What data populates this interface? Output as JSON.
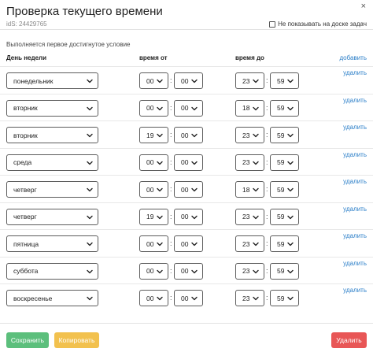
{
  "header": {
    "title": "Проверка текущего времени",
    "ids": "idS: 24429765",
    "close_glyph": "×",
    "hide_label": "Не показывать на доске задач"
  },
  "subtitle": "Выполняется первое достигнутое условие",
  "columns": {
    "day": "День недели",
    "from": "время от",
    "to": "время до",
    "add": "добавить"
  },
  "delete_label": "удалить",
  "rows": [
    {
      "day": "понедельник",
      "from_h": "00",
      "from_m": "00",
      "to_h": "23",
      "to_m": "59"
    },
    {
      "day": "вторник",
      "from_h": "00",
      "from_m": "00",
      "to_h": "18",
      "to_m": "59"
    },
    {
      "day": "вторник",
      "from_h": "19",
      "from_m": "00",
      "to_h": "23",
      "to_m": "59"
    },
    {
      "day": "среда",
      "from_h": "00",
      "from_m": "00",
      "to_h": "23",
      "to_m": "59"
    },
    {
      "day": "четверг",
      "from_h": "00",
      "from_m": "00",
      "to_h": "18",
      "to_m": "59"
    },
    {
      "day": "четверг",
      "from_h": "19",
      "from_m": "00",
      "to_h": "23",
      "to_m": "59"
    },
    {
      "day": "пятница",
      "from_h": "00",
      "from_m": "00",
      "to_h": "23",
      "to_m": "59"
    },
    {
      "day": "суббота",
      "from_h": "00",
      "from_m": "00",
      "to_h": "23",
      "to_m": "59"
    },
    {
      "day": "воскресенье",
      "from_h": "00",
      "from_m": "00",
      "to_h": "23",
      "to_m": "59"
    }
  ],
  "footer": {
    "save": "Сохранить",
    "copy": "Копировать",
    "delete": "Удалить"
  },
  "colors": {
    "save": "#5cbf7c",
    "copy": "#f2c14e",
    "delete": "#e85656",
    "link": "#2a7ec8"
  }
}
